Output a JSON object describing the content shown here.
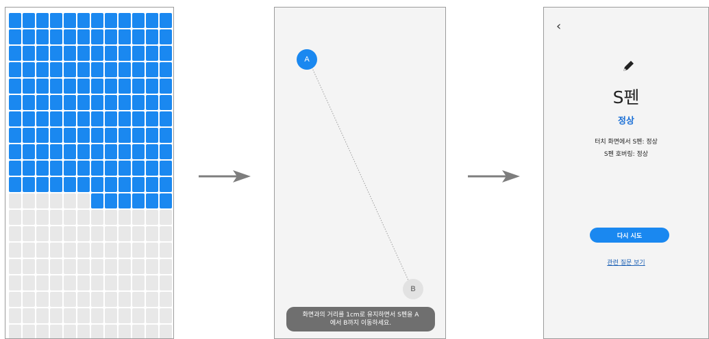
{
  "screen1": {
    "grid": {
      "columns": 12,
      "rows": 20,
      "filled_full_rows": 11,
      "partial_row_filled": 6
    },
    "active_color": "#1a88f0",
    "inactive_color": "#e8e8e8"
  },
  "arrows": {
    "icon": "right-arrow-icon",
    "color": "#7d7d7d"
  },
  "screen2": {
    "point_a": "A",
    "point_b": "B",
    "instruction_line1": "화면과의 거리를 1cm로 유지하면서 S펜을 A",
    "instruction_line2": "에서 B까지 이동하세요."
  },
  "screen3": {
    "back_icon": "back-chevron-icon",
    "pen_icon": "pen-icon",
    "title": "S펜",
    "status": "정상",
    "detail_touch": "터치 화면에서 S펜: 정상",
    "detail_hover": "S펜 호버링: 정상",
    "retry_button": "다시 시도",
    "related_link": "관련 질문 보기",
    "accent_color": "#1a88f0"
  }
}
